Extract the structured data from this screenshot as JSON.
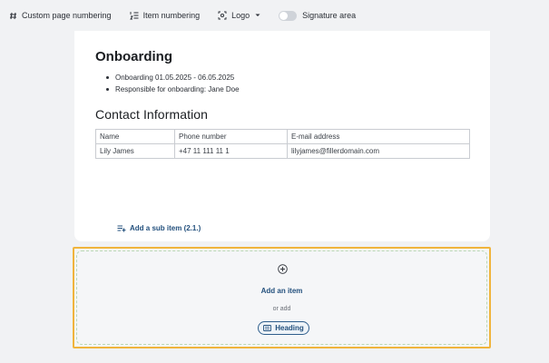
{
  "toolbar": {
    "custom_page_numbering": "Custom page numbering",
    "item_numbering": "Item numbering",
    "logo": "Logo",
    "signature_area": "Signature area",
    "signature_area_enabled": false
  },
  "document": {
    "title": "Onboarding",
    "bullets": [
      "Onboarding 01.05.2025 - 06.05.2025",
      "Responsible for onboarding: Jane Doe"
    ],
    "section_title": "Contact Information",
    "table": {
      "headers": [
        "Name",
        "Phone number",
        "E-mail address"
      ],
      "rows": [
        [
          "Lily James",
          "+47 11 111 11 1",
          "lilyjames@fillerdomain.com"
        ]
      ]
    },
    "add_sub_item": "Add a sub item (2.1.)"
  },
  "add_zone": {
    "add_item": "Add an item",
    "or_add": "or add",
    "heading_button": "Heading"
  },
  "colors": {
    "accent": "#23507d",
    "highlight_border": "#f0b43c",
    "background": "#f1f2f4"
  },
  "icons": {
    "custom_page_numbering": "hash-icon",
    "item_numbering": "numbered-list-icon",
    "logo": "image-frame-icon",
    "sub_item": "add-list-icon",
    "add_item": "plus-circle-icon",
    "heading": "heading-icon"
  }
}
